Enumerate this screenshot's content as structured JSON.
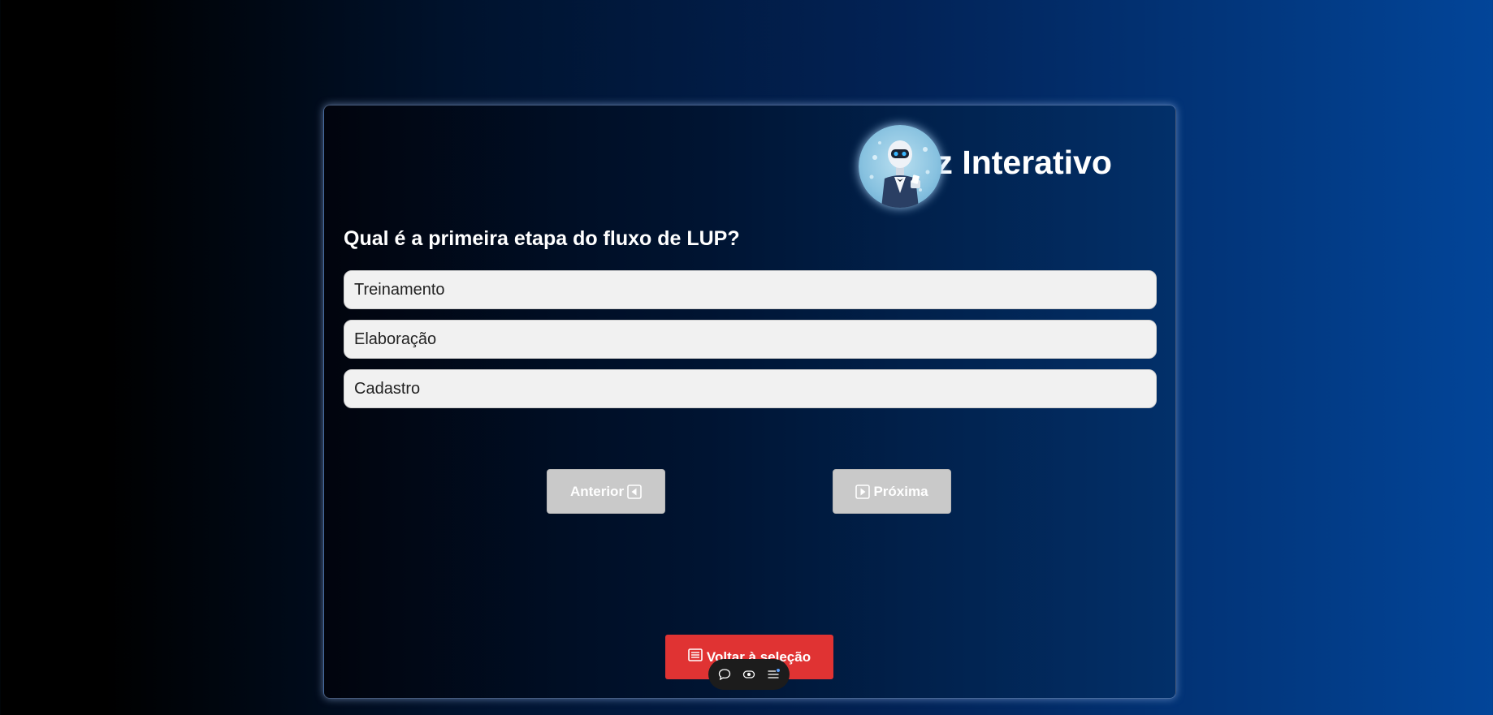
{
  "quiz": {
    "title": "Quiz Interativo",
    "question": "Qual é a primeira etapa do fluxo de LUP?",
    "options": [
      {
        "label": "Treinamento"
      },
      {
        "label": "Elaboração"
      },
      {
        "label": "Cadastro"
      }
    ]
  },
  "navigation": {
    "prev_label": "Anterior",
    "next_label": "Próxima",
    "back_label": "Voltar à seleção"
  },
  "toolbar": {
    "icons": [
      "chat-bubble-icon",
      "eye-icon",
      "list-icon"
    ]
  },
  "icons": {
    "prev": "caret-left-square-icon",
    "next": "caret-right-square-icon",
    "back": "list-card-icon",
    "avatar": "robot-avatar"
  },
  "colors": {
    "back_button": "#e03333",
    "nav_button": "#c9c9c9",
    "option_background": "#f1f1f1",
    "toolbar_background": "#1c1c1c"
  }
}
